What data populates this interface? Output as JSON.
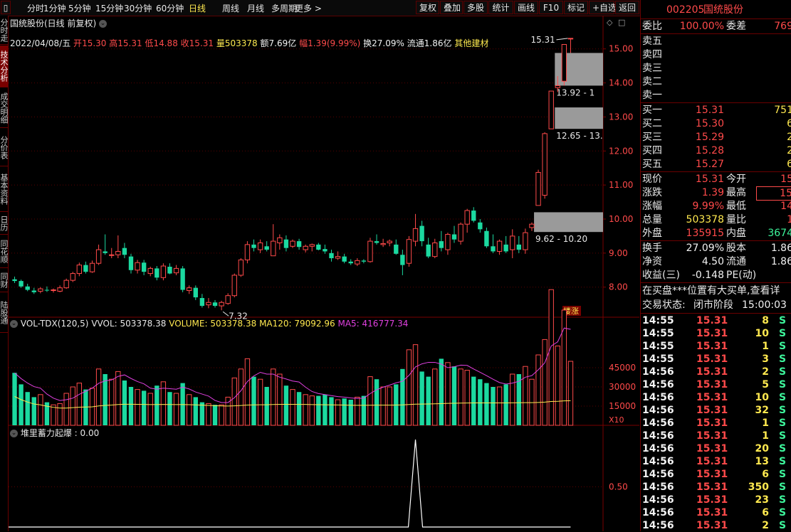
{
  "toolbar": {
    "left_items": [
      "分时",
      "1分钟",
      "5分钟",
      "15分钟",
      "30分钟",
      "60分钟",
      "日线",
      "周线",
      "月线",
      "多周期",
      "更多 >"
    ],
    "active": "日线",
    "right_items": [
      "复权",
      "叠加",
      "多股",
      "统计",
      "画线",
      "F10",
      "标记",
      "+自选",
      "返回"
    ]
  },
  "left_tabs": [
    {
      "label": "分时走势",
      "active": false
    },
    {
      "label": "技术分析",
      "active": true
    },
    {
      "label": "成交明细",
      "active": false
    },
    {
      "label": "分价表",
      "active": false
    },
    {
      "label": "基本资料",
      "active": false
    },
    {
      "label": "日历",
      "active": false
    },
    {
      "label": "同花顺",
      "active": false
    },
    {
      "label": "同财",
      "active": false
    },
    {
      "label": "陆股通",
      "active": false
    }
  ],
  "chart_header": {
    "title": "国统股份(日线 前复权)",
    "date": "2022/04/08/五",
    "open_label": "开",
    "open": "15.30",
    "high_label": "高",
    "high": "15.31",
    "low_label": "低",
    "low": "14.88",
    "close_label": "收",
    "close": "15.31",
    "vol_label": "量",
    "vol": "503378",
    "amt_label": "额",
    "amt": "7.69亿",
    "chg_label": "幅",
    "chg": "1.39(9.99%)",
    "turnover_label": "换",
    "turnover": "27.09%",
    "float_label": "流通",
    "float": "1.86亿",
    "industry": "其他建材"
  },
  "annotations": {
    "high_marker": "15.31",
    "low_marker": "7.32",
    "zone1": "9.62 - 10.20",
    "zone2": "12.65 - 13.",
    "zone3": "13.92 - 1",
    "badge": "楼涨"
  },
  "volume_header": {
    "name": "VOL-TDX(120,5)",
    "vvol": "VVOL: 503378.38",
    "volume": "VOLUME: 503378.38",
    "ma120": "MA120: 79092.96",
    "ma5": "MA5: 416777.34",
    "x10": "X10"
  },
  "indicator_header": {
    "name": "堆里蓄力起爆 : 0.00"
  },
  "chart_data": [
    {
      "type": "candlestick",
      "title": "国统股份(日线 前复权)",
      "ylim": [
        7.2,
        15.6
      ],
      "y_ticks": [
        8.0,
        9.0,
        10.0,
        11.0,
        12.0,
        13.0,
        14.0,
        15.0
      ],
      "candles": [
        [
          8.23,
          8.31,
          8.12,
          8.18
        ],
        [
          8.18,
          8.22,
          7.98,
          8.02
        ],
        [
          8.02,
          8.1,
          7.88,
          7.92
        ],
        [
          7.9,
          7.98,
          7.8,
          7.85
        ],
        [
          7.88,
          8.0,
          7.82,
          7.95
        ],
        [
          7.92,
          8.02,
          7.86,
          7.9
        ],
        [
          7.9,
          7.96,
          7.84,
          7.92
        ],
        [
          7.88,
          8.05,
          7.85,
          7.98
        ],
        [
          7.98,
          8.25,
          7.95,
          8.2
        ],
        [
          8.2,
          8.45,
          8.15,
          8.4
        ],
        [
          8.4,
          8.72,
          8.32,
          8.65
        ],
        [
          8.65,
          8.75,
          8.4,
          8.45
        ],
        [
          8.45,
          8.78,
          8.42,
          8.7
        ],
        [
          8.7,
          9.25,
          8.65,
          9.1
        ],
        [
          9.05,
          9.55,
          8.95,
          9.0
        ],
        [
          8.95,
          9.15,
          8.85,
          8.95
        ],
        [
          8.95,
          9.52,
          8.85,
          9.05
        ],
        [
          9.15,
          9.3,
          8.85,
          8.95
        ],
        [
          8.9,
          8.98,
          8.4,
          8.5
        ],
        [
          8.5,
          8.8,
          8.4,
          8.72
        ],
        [
          8.72,
          8.8,
          8.35,
          8.45
        ],
        [
          8.4,
          8.6,
          8.32,
          8.55
        ],
        [
          8.55,
          8.62,
          8.2,
          8.28
        ],
        [
          8.28,
          8.7,
          8.2,
          8.62
        ],
        [
          8.6,
          8.7,
          8.38,
          8.4
        ],
        [
          8.42,
          8.65,
          8.35,
          8.55
        ],
        [
          8.55,
          8.62,
          7.85,
          7.92
        ],
        [
          7.9,
          8.05,
          7.8,
          7.98
        ],
        [
          7.98,
          8.05,
          7.62,
          7.7
        ],
        [
          7.68,
          7.8,
          7.4,
          7.45
        ],
        [
          7.48,
          7.68,
          7.38,
          7.55
        ],
        [
          7.55,
          7.62,
          7.4,
          7.45
        ],
        [
          7.45,
          7.6,
          7.32,
          7.55
        ],
        [
          7.52,
          7.82,
          7.48,
          7.75
        ],
        [
          7.75,
          8.4,
          7.7,
          8.35
        ],
        [
          8.35,
          8.85,
          8.3,
          8.8
        ],
        [
          8.8,
          9.35,
          8.7,
          9.25
        ],
        [
          9.25,
          9.4,
          9.05,
          9.15
        ],
        [
          9.1,
          9.4,
          9.0,
          9.3
        ],
        [
          9.2,
          9.35,
          9.05,
          9.1
        ],
        [
          8.92,
          9.85,
          8.92,
          9.35
        ],
        [
          9.3,
          9.55,
          9.1,
          9.45
        ],
        [
          9.4,
          9.52,
          9.05,
          9.15
        ],
        [
          9.2,
          9.4,
          9.15,
          9.35
        ],
        [
          9.35,
          9.42,
          9.1,
          9.18
        ],
        [
          9.1,
          9.25,
          9.02,
          9.2
        ],
        [
          9.2,
          9.28,
          9.05,
          9.25
        ],
        [
          9.25,
          9.3,
          9.08,
          9.1
        ],
        [
          9.12,
          9.25,
          8.98,
          9.05
        ],
        [
          9.0,
          9.1,
          8.75,
          8.85
        ],
        [
          8.85,
          9.05,
          8.8,
          8.9
        ],
        [
          8.9,
          8.98,
          8.7,
          8.75
        ],
        [
          8.75,
          8.82,
          8.65,
          8.7
        ],
        [
          8.68,
          8.85,
          8.62,
          8.78
        ],
        [
          8.78,
          8.82,
          8.7,
          8.75
        ],
        [
          8.75,
          9.45,
          8.72,
          9.35
        ],
        [
          9.35,
          9.55,
          9.25,
          9.3
        ],
        [
          9.25,
          9.42,
          9.18,
          9.28
        ],
        [
          9.3,
          9.4,
          9.2,
          9.35
        ],
        [
          9.25,
          9.4,
          8.95,
          8.98
        ],
        [
          8.95,
          9.1,
          8.35,
          8.65
        ],
        [
          8.7,
          9.5,
          8.6,
          9.4
        ],
        [
          9.35,
          10.15,
          9.2,
          9.72
        ],
        [
          9.8,
          9.95,
          9.2,
          9.35
        ],
        [
          9.25,
          9.45,
          8.85,
          8.9
        ],
        [
          8.9,
          9.42,
          8.85,
          9.3
        ],
        [
          9.35,
          9.65,
          9.05,
          9.15
        ],
        [
          9.1,
          9.6,
          8.95,
          9.55
        ],
        [
          9.55,
          9.8,
          9.3,
          9.4
        ],
        [
          9.35,
          9.9,
          9.25,
          9.85
        ],
        [
          9.85,
          10.3,
          9.6,
          10.25
        ],
        [
          10.25,
          10.35,
          9.9,
          9.95
        ],
        [
          9.9,
          10.0,
          9.6,
          9.7
        ],
        [
          9.65,
          9.75,
          9.15,
          9.2
        ],
        [
          9.2,
          9.55,
          9.0,
          9.05
        ],
        [
          9.05,
          9.4,
          8.95,
          9.35
        ],
        [
          9.25,
          9.5,
          9.0,
          9.05
        ],
        [
          9.1,
          9.7,
          8.85,
          9.5
        ],
        [
          9.25,
          9.5,
          9.0,
          9.1
        ],
        [
          9.1,
          9.72,
          8.98,
          9.6
        ],
        [
          9.75,
          9.9,
          9.65,
          9.85
        ],
        [
          10.4,
          11.45,
          10.4,
          11.37
        ],
        [
          10.7,
          12.55,
          10.6,
          12.51
        ],
        [
          12.65,
          13.76,
          12.65,
          13.76
        ],
        [
          13.86,
          14.2,
          13.73,
          13.92
        ],
        [
          14.05,
          15.13,
          13.92,
          15.13
        ],
        [
          15.3,
          15.31,
          14.88,
          15.31
        ]
      ],
      "volume": [
        41000,
        32000,
        26000,
        22000,
        24000,
        18000,
        16000,
        17000,
        25000,
        30000,
        33000,
        28000,
        29000,
        44000,
        40000,
        36000,
        42000,
        35000,
        30000,
        28000,
        27000,
        25000,
        31000,
        34000,
        26000,
        25000,
        33000,
        24000,
        22000,
        18000,
        17000,
        16000,
        16000,
        22000,
        37000,
        44000,
        52000,
        38000,
        36000,
        30000,
        44000,
        40000,
        31000,
        28000,
        26000,
        24000,
        23000,
        23000,
        24000,
        22000,
        20000,
        21000,
        20000,
        22000,
        23000,
        38000,
        36000,
        30000,
        30000,
        32000,
        44000,
        59000,
        63000,
        42000,
        38000,
        44000,
        52000,
        49000,
        46000,
        44000,
        43000,
        38000,
        36000,
        33000,
        30000,
        30000,
        32000,
        40000,
        40000,
        46000,
        36000,
        55000,
        67000,
        106000,
        62000,
        90000,
        50000
      ],
      "vol_ylim": [
        0,
        70000
      ],
      "vol_ticks": [
        15000,
        30000,
        45000
      ],
      "indicator_ticks": [
        0.5
      ],
      "spike_index": 62
    }
  ],
  "right_panel": {
    "code": "002205",
    "name": "国统股份",
    "weibi_label": "委比",
    "weibi": "100.00%",
    "weicha_label": "委差",
    "weicha": "769",
    "sell": [
      {
        "label": "卖五",
        "price": "",
        "vol": ""
      },
      {
        "label": "卖四",
        "price": "",
        "vol": ""
      },
      {
        "label": "卖三",
        "price": "",
        "vol": ""
      },
      {
        "label": "卖二",
        "price": "",
        "vol": ""
      },
      {
        "label": "卖一",
        "price": "",
        "vol": ""
      }
    ],
    "buy": [
      {
        "label": "买一",
        "price": "15.31",
        "vol": "751"
      },
      {
        "label": "买二",
        "price": "15.30",
        "vol": "6"
      },
      {
        "label": "买三",
        "price": "15.29",
        "vol": "2"
      },
      {
        "label": "买四",
        "price": "15.28",
        "vol": "2"
      },
      {
        "label": "买五",
        "price": "15.27",
        "vol": "6"
      }
    ],
    "quote": [
      {
        "l1": "现价",
        "v1": "15.31",
        "c1": "red",
        "l2": "今开",
        "v2": "15",
        "c2": "red"
      },
      {
        "l1": "涨跌",
        "v1": "1.39",
        "c1": "red",
        "l2": "最高",
        "v2": "15",
        "c2": "red",
        "box": true
      },
      {
        "l1": "涨幅",
        "v1": "9.99%",
        "c1": "red",
        "l2": "最低",
        "v2": "14",
        "c2": "red"
      },
      {
        "l1": "总量",
        "v1": "503378",
        "c1": "yel",
        "l2": "量比",
        "v2": "1",
        "c2": "red"
      },
      {
        "l1": "外盘",
        "v1": "135915",
        "c1": "red",
        "l2": "内盘",
        "v2": "3674",
        "c2": "grn"
      }
    ],
    "fund": [
      {
        "l1": "换手",
        "v1": "27.09%",
        "l2": "股本",
        "v2": "1.86"
      },
      {
        "l1": "净资",
        "v1": "4.50",
        "l2": "流通",
        "v2": "1.86"
      },
      {
        "l1": "收益(三)",
        "v1": "-0.148",
        "l2": "PE(动)",
        "v2": ""
      }
    ],
    "notice": "在买盘***位置有大买单,查看详",
    "trade_status_label": "交易状态:",
    "trade_status": "闭市阶段",
    "trade_time": "15:00:03",
    "ticks": [
      {
        "t": "14:55",
        "p": "15.31",
        "v": "8",
        "s": "S"
      },
      {
        "t": "14:55",
        "p": "15.31",
        "v": "10",
        "s": "S"
      },
      {
        "t": "14:55",
        "p": "15.31",
        "v": "1",
        "s": "S"
      },
      {
        "t": "14:55",
        "p": "15.31",
        "v": "3",
        "s": "S"
      },
      {
        "t": "14:56",
        "p": "15.31",
        "v": "2",
        "s": "S"
      },
      {
        "t": "14:56",
        "p": "15.31",
        "v": "5",
        "s": "S"
      },
      {
        "t": "14:56",
        "p": "15.31",
        "v": "10",
        "s": "S"
      },
      {
        "t": "14:56",
        "p": "15.31",
        "v": "32",
        "s": "S"
      },
      {
        "t": "14:56",
        "p": "15.31",
        "v": "1",
        "s": "S"
      },
      {
        "t": "14:56",
        "p": "15.31",
        "v": "1",
        "s": "S"
      },
      {
        "t": "14:56",
        "p": "15.31",
        "v": "20",
        "s": "S"
      },
      {
        "t": "14:56",
        "p": "15.31",
        "v": "13",
        "s": "S"
      },
      {
        "t": "14:56",
        "p": "15.31",
        "v": "6",
        "s": "S"
      },
      {
        "t": "14:56",
        "p": "15.31",
        "v": "350",
        "s": "S"
      },
      {
        "t": "14:56",
        "p": "15.31",
        "v": "23",
        "s": "S"
      },
      {
        "t": "14:56",
        "p": "15.31",
        "v": "6",
        "s": "S"
      },
      {
        "t": "14:56",
        "p": "15.31",
        "v": "2",
        "s": "S"
      }
    ],
    "colors": {
      "up": "#ff4a4a",
      "down": "#1bd9a0",
      "ma5": "#e040e0",
      "ma120": "#ffe94f",
      "grid": "#7a0000"
    }
  }
}
